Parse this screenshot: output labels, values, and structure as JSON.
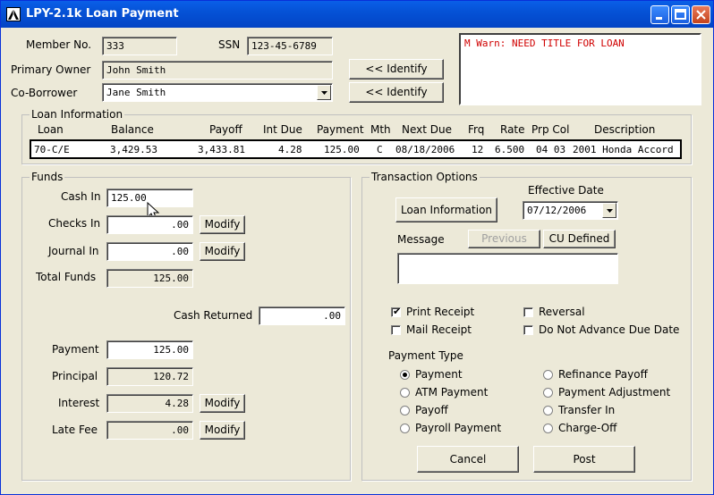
{
  "window": {
    "title": "LPY-2.1k Loan Payment"
  },
  "member": {
    "member_no_label": "Member No.",
    "member_no": "333",
    "ssn_label": "SSN",
    "ssn": "123-45-6789",
    "primary_owner_label": "Primary Owner",
    "primary_owner": "John Smith",
    "co_borrower_label": "Co-Borrower",
    "co_borrower": "Jane Smith",
    "identify_label": "<< Identify"
  },
  "warning": "M Warn: NEED TITLE FOR LOAN",
  "loan_info": {
    "group_title": "Loan Information",
    "headers": {
      "loan": "Loan",
      "balance": "Balance",
      "payoff": "Payoff",
      "int_due": "Int Due",
      "payment": "Payment",
      "mth": "Mth",
      "next_due": "Next Due",
      "frq": "Frq",
      "rate": "Rate",
      "prp_col": "Prp Col",
      "description": "Description"
    },
    "row": {
      "loan": "70-C/E",
      "balance": "3,429.53",
      "payoff": "3,433.81",
      "int_due": "4.28",
      "payment": "125.00",
      "mth": "C",
      "next_due": "08/18/2006",
      "frq": "12",
      "rate": "6.500",
      "prp_col": "04 03",
      "description": "2001 Honda Accord"
    }
  },
  "funds": {
    "group_title": "Funds",
    "cash_in_label": "Cash In",
    "cash_in": "125.00",
    "checks_in_label": "Checks In",
    "checks_in": ".00",
    "journal_in_label": "Journal In",
    "journal_in": ".00",
    "total_funds_label": "Total Funds",
    "total_funds": "125.00",
    "cash_returned_label": "Cash Returned",
    "cash_returned": ".00",
    "payment_label": "Payment",
    "payment": "125.00",
    "principal_label": "Principal",
    "principal": "120.72",
    "interest_label": "Interest",
    "interest": "4.28",
    "late_fee_label": "Late Fee",
    "late_fee": ".00",
    "modify_label": "Modify"
  },
  "txn": {
    "group_title": "Transaction Options",
    "effective_date_label": "Effective Date",
    "effective_date": "07/12/2006",
    "loan_information_button": "Loan Information",
    "message_label": "Message",
    "previous_button": "Previous",
    "cu_defined_button": "CU Defined",
    "message": "",
    "print_receipt": "Print Receipt",
    "mail_receipt": "Mail Receipt",
    "reversal": "Reversal",
    "do_not_advance": "Do Not Advance Due Date",
    "payment_type_label": "Payment Type",
    "payment_types": [
      "Payment",
      "ATM Payment",
      "Payoff",
      "Payroll Payment",
      "Refinance Payoff",
      "Payment Adjustment",
      "Transfer In",
      "Charge-Off"
    ],
    "cancel_button": "Cancel",
    "post_button": "Post"
  },
  "colors": {
    "titlebar": "#0552d6",
    "warning_text": "#d00000",
    "face": "#ece9d8"
  }
}
